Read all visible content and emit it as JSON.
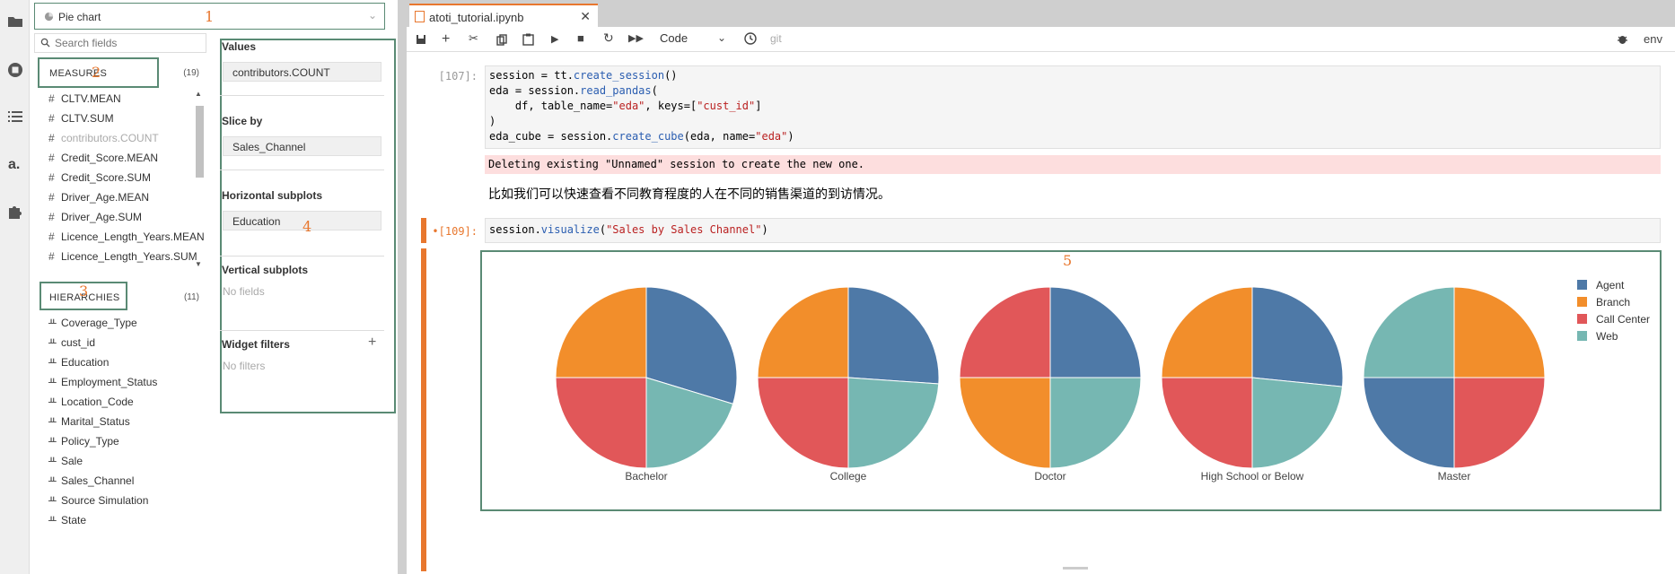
{
  "colors": {
    "accent": "#e8772e",
    "highlight": "#5a8a74",
    "agent": "#4e79a7",
    "branch": "#f28e2b",
    "call_center": "#e15759",
    "web": "#76b7b2"
  },
  "sidebar": {
    "chart_type": "Pie chart",
    "search_placeholder": "Search fields",
    "measures_title": "MEASURES",
    "measures_count": "(19)",
    "measures": [
      {
        "label": "CLTV.MEAN",
        "dim": false
      },
      {
        "label": "CLTV.SUM",
        "dim": false
      },
      {
        "label": "contributors.COUNT",
        "dim": true
      },
      {
        "label": "Credit_Score.MEAN",
        "dim": false
      },
      {
        "label": "Credit_Score.SUM",
        "dim": false
      },
      {
        "label": "Driver_Age.MEAN",
        "dim": false
      },
      {
        "label": "Driver_Age.SUM",
        "dim": false
      },
      {
        "label": "Licence_Length_Years.MEAN",
        "dim": false
      },
      {
        "label": "Licence_Length_Years.SUM",
        "dim": false
      }
    ],
    "hierarchies_title": "HIERARCHIES",
    "hierarchies_count": "(11)",
    "hierarchies": [
      "Coverage_Type",
      "cust_id",
      "Education",
      "Employment_Status",
      "Location_Code",
      "Marital_Status",
      "Policy_Type",
      "Sale",
      "Sales_Channel",
      "Source Simulation",
      "State"
    ]
  },
  "config": {
    "values_title": "Values",
    "values_field": "contributors.COUNT",
    "slice_title": "Slice by",
    "slice_field": "Sales_Channel",
    "hsub_title": "Horizontal subplots",
    "hsub_field": "Education",
    "vsub_title": "Vertical subplots",
    "vsub_empty": "No fields",
    "filters_title": "Widget filters",
    "filters_empty": "No filters"
  },
  "annotations": [
    "1",
    "2",
    "3",
    "4",
    "5"
  ],
  "notebook": {
    "tab_title": "atoti_tutorial.ipynb",
    "cell_type": "Code",
    "git_label": "git",
    "kernel": "env",
    "cell1_prompt": "[107]:",
    "cell1_lines": [
      [
        {
          "t": "session = tt."
        },
        {
          "t": "create_session",
          "c": "fn"
        },
        {
          "t": "()"
        }
      ],
      [
        {
          "t": "eda = session."
        },
        {
          "t": "read_pandas",
          "c": "fn"
        },
        {
          "t": "("
        }
      ],
      [
        {
          "t": "    df, table_name="
        },
        {
          "t": "\"eda\"",
          "c": "str"
        },
        {
          "t": ", keys=["
        },
        {
          "t": "\"cust_id\"",
          "c": "str"
        },
        {
          "t": "]"
        }
      ],
      [
        {
          "t": ")"
        }
      ],
      [
        {
          "t": "eda_cube = session."
        },
        {
          "t": "create_cube",
          "c": "fn"
        },
        {
          "t": "(eda, name="
        },
        {
          "t": "\"eda\"",
          "c": "str"
        },
        {
          "t": ")"
        }
      ]
    ],
    "error_text": "Deleting existing \"Unnamed\" session to create the new one.",
    "markdown_text": "比如我们可以快速查看不同教育程度的人在不同的销售渠道的到访情况。",
    "cell2_prompt": "•[109]:",
    "cell2_line": [
      {
        "t": "session."
      },
      {
        "t": "visualize",
        "c": "fn"
      },
      {
        "t": "("
      },
      {
        "t": "\"Sales by Sales Channel\"",
        "c": "str"
      },
      {
        "t": ")"
      }
    ]
  },
  "chart_data": {
    "type": "pie",
    "slice_by": "Sales_Channel",
    "legend_position": "top-right",
    "legend": [
      {
        "name": "Agent",
        "color": "#4e79a7"
      },
      {
        "name": "Branch",
        "color": "#f28e2b"
      },
      {
        "name": "Call Center",
        "color": "#e15759"
      },
      {
        "name": "Web",
        "color": "#76b7b2"
      }
    ],
    "pies": [
      {
        "label": "Bachelor",
        "slices": [
          {
            "name": "Agent",
            "value": 0.297
          },
          {
            "name": "Web",
            "value": 0.203
          },
          {
            "name": "Call Center",
            "value": 0.25
          },
          {
            "name": "Branch",
            "value": 0.25
          }
        ]
      },
      {
        "label": "College",
        "slices": [
          {
            "name": "Agent",
            "value": 0.261
          },
          {
            "name": "Web",
            "value": 0.239
          },
          {
            "name": "Call Center",
            "value": 0.25
          },
          {
            "name": "Branch",
            "value": 0.25
          }
        ]
      },
      {
        "label": "Doctor",
        "slices": [
          {
            "name": "Agent",
            "value": 0.25
          },
          {
            "name": "Web",
            "value": 0.25
          },
          {
            "name": "Branch",
            "value": 0.25
          },
          {
            "name": "Call Center",
            "value": 0.25
          }
        ]
      },
      {
        "label": "High School or Below",
        "slices": [
          {
            "name": "Agent",
            "value": 0.266
          },
          {
            "name": "Web",
            "value": 0.234
          },
          {
            "name": "Call Center",
            "value": 0.25
          },
          {
            "name": "Branch",
            "value": 0.25
          }
        ]
      },
      {
        "label": "Master",
        "slices": [
          {
            "name": "Branch",
            "value": 0.25
          },
          {
            "name": "Call Center",
            "value": 0.25
          },
          {
            "name": "Agent",
            "value": 0.25
          },
          {
            "name": "Web",
            "value": 0.25
          }
        ]
      }
    ]
  }
}
